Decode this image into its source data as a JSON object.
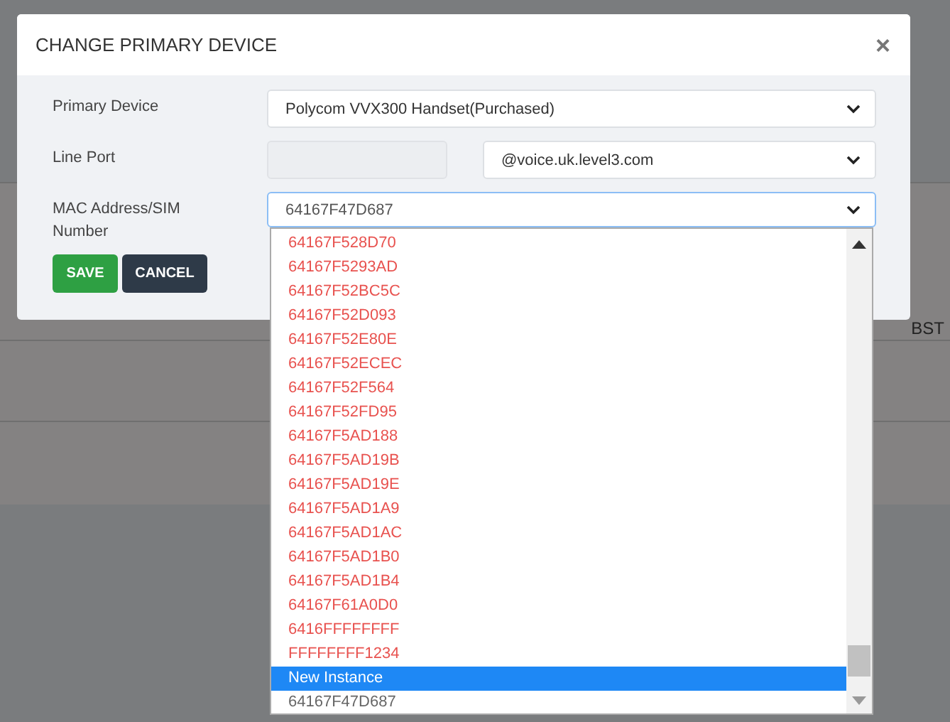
{
  "background": {
    "text": "BST"
  },
  "dialog": {
    "title": "CHANGE PRIMARY DEVICE",
    "close": "×"
  },
  "fields": [
    {
      "label": "Primary Device",
      "kind": "select",
      "value": "Polycom VVX300 Handset(Purchased)"
    },
    {
      "label": "Line Port",
      "kind": "split",
      "value": "@voice.uk.level3.com"
    },
    {
      "label": "MAC Address/SIM Number",
      "kind": "select-open",
      "value": "64167F47D687"
    }
  ],
  "buttons": [
    {
      "label": "SAVE",
      "kind": "primary"
    },
    {
      "label": "CANCEL",
      "kind": "secondary"
    }
  ],
  "options": [
    {
      "text": "64167F528D70",
      "color": "#e8524f",
      "selected": false
    },
    {
      "text": "64167F5293AD",
      "color": "#e8524f",
      "selected": false
    },
    {
      "text": "64167F52BC5C",
      "color": "#e8524f",
      "selected": false
    },
    {
      "text": "64167F52D093",
      "color": "#e8524f",
      "selected": false
    },
    {
      "text": "64167F52E80E",
      "color": "#e8524f",
      "selected": false
    },
    {
      "text": "64167F52ECEC",
      "color": "#e8524f",
      "selected": false
    },
    {
      "text": "64167F52F564",
      "color": "#e8524f",
      "selected": false
    },
    {
      "text": "64167F52FD95",
      "color": "#e8524f",
      "selected": false
    },
    {
      "text": "64167F5AD188",
      "color": "#e8524f",
      "selected": false
    },
    {
      "text": "64167F5AD19B",
      "color": "#e8524f",
      "selected": false
    },
    {
      "text": "64167F5AD19E",
      "color": "#e8524f",
      "selected": false
    },
    {
      "text": "64167F5AD1A9",
      "color": "#e8524f",
      "selected": false
    },
    {
      "text": "64167F5AD1AC",
      "color": "#e8524f",
      "selected": false
    },
    {
      "text": "64167F5AD1B0",
      "color": "#e8524f",
      "selected": false
    },
    {
      "text": "64167F5AD1B4",
      "color": "#e8524f",
      "selected": false
    },
    {
      "text": "64167F61A0D0",
      "color": "#e8524f",
      "selected": false
    },
    {
      "text": "6416FFFFFFFF",
      "color": "#e8524f",
      "selected": false
    },
    {
      "text": "FFFFFFFF1234",
      "color": "#e8524f",
      "selected": false
    },
    {
      "text": "New Instance",
      "kind": "action",
      "selected": true
    },
    {
      "text": "64167F47D687",
      "kind": "current",
      "selected": false
    }
  ]
}
